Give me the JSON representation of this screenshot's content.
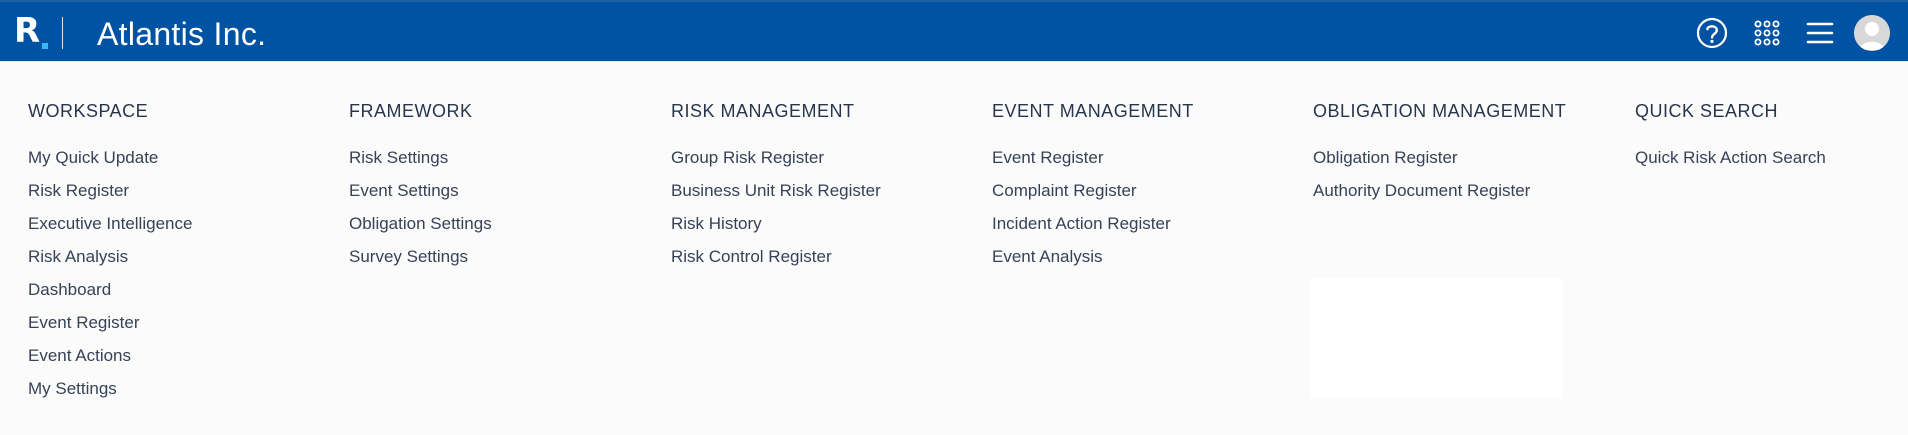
{
  "header": {
    "logo_letter": "R",
    "company_name": "Atlantis Inc.",
    "background_color": "#0052a3",
    "logo_dot_color": "#38b7f0",
    "icons": [
      "help-icon",
      "apps-grid-icon",
      "hamburger-menu-icon",
      "avatar"
    ]
  },
  "columns": [
    {
      "title": "WORKSPACE",
      "items": [
        "My Quick Update",
        "Risk Register",
        "Executive Intelligence",
        "Risk Analysis",
        "Dashboard",
        "Event Register",
        "Event Actions",
        "My Settings"
      ]
    },
    {
      "title": "FRAMEWORK",
      "items": [
        "Risk Settings",
        "Event Settings",
        "Obligation Settings",
        "Survey Settings"
      ]
    },
    {
      "title": "RISK MANAGEMENT",
      "items": [
        "Group Risk Register",
        "Business Unit Risk Register",
        "Risk History",
        "Risk Control Register"
      ]
    },
    {
      "title": "EVENT MANAGEMENT",
      "items": [
        "Event Register",
        "Complaint Register",
        "Incident Action Register",
        "Event Analysis"
      ]
    },
    {
      "title": "OBLIGATION MANAGEMENT",
      "items": [
        "Obligation Register",
        "Authority Document Register"
      ]
    },
    {
      "title": "QUICK SEARCH",
      "items": [
        "Quick Risk Action Search"
      ]
    }
  ]
}
